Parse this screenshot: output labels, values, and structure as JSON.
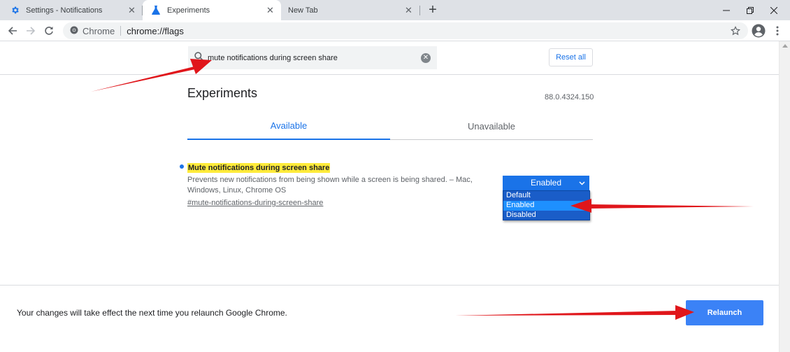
{
  "tabs": [
    {
      "title": "Settings - Notifications",
      "icon": "gear-icon"
    },
    {
      "title": "Experiments",
      "icon": "flask-icon"
    },
    {
      "title": "New Tab",
      "icon": ""
    }
  ],
  "omnibox": {
    "site_label": "Chrome",
    "url": "chrome://flags"
  },
  "search": {
    "value": "mute notifications during screen share",
    "placeholder": "Search flags"
  },
  "header": {
    "reset_label": "Reset all"
  },
  "page": {
    "title": "Experiments",
    "version": "88.0.4324.150",
    "tabs": [
      {
        "label": "Available"
      },
      {
        "label": "Unavailable"
      }
    ]
  },
  "flag": {
    "name": "Mute notifications during screen share",
    "description": "Prevents new notifications from being shown while a screen is being shared. – Mac, Windows, Linux, Chrome OS",
    "link": "#mute-notifications-during-screen-share",
    "selected": "Enabled",
    "options": [
      "Default",
      "Enabled",
      "Disabled"
    ]
  },
  "footer": {
    "message": "Your changes will take effect the next time you relaunch Google Chrome.",
    "relaunch_label": "Relaunch"
  },
  "colors": {
    "accent": "#1a73e8",
    "highlight": "#ffeb3b",
    "annotation": "#e0161b"
  }
}
